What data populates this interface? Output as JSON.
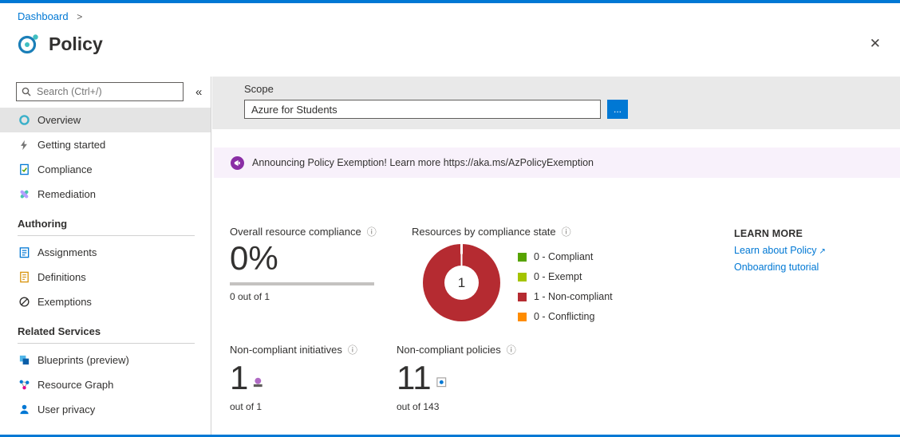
{
  "colors": {
    "brand_blue": "#0078d4",
    "non_compliant_red": "#b52b31",
    "compliant_green": "#57a300",
    "exempt_green": "#a4c400",
    "conflicting_orange": "#ff8c00",
    "banner_purple": "#8a2da5"
  },
  "icons": {
    "close": "✕",
    "collapse": "«",
    "info": "ⓘ",
    "external": "↗",
    "breadcrumb_separator": ">"
  },
  "breadcrumb": {
    "items": [
      {
        "label": "Dashboard"
      }
    ]
  },
  "page": {
    "title": "Policy"
  },
  "sidebar": {
    "search_placeholder": "Search (Ctrl+/)",
    "items": [
      {
        "label": "Overview",
        "selected": true
      },
      {
        "label": "Getting started"
      },
      {
        "label": "Compliance"
      },
      {
        "label": "Remediation"
      }
    ],
    "sections": [
      {
        "title": "Authoring",
        "items": [
          {
            "label": "Assignments"
          },
          {
            "label": "Definitions"
          },
          {
            "label": "Exemptions"
          }
        ]
      },
      {
        "title": "Related Services",
        "items": [
          {
            "label": "Blueprints (preview)"
          },
          {
            "label": "Resource Graph"
          },
          {
            "label": "User privacy"
          }
        ]
      }
    ]
  },
  "scope": {
    "label": "Scope",
    "value": "Azure for Students",
    "browse_button": "..."
  },
  "banner": {
    "message": "Announcing Policy Exemption! Learn more",
    "link": "https://aka.ms/AzPolicyExemption"
  },
  "overall_compliance": {
    "title": "Overall resource compliance",
    "percent": "0%",
    "subtext": "0 out of 1"
  },
  "compliance_state": {
    "title": "Resources by compliance state",
    "center_value": "1"
  },
  "chart_data": {
    "type": "pie",
    "title": "Resources by compliance state",
    "labels": [
      "0 - Compliant",
      "0 - Exempt",
      "1 - Non-compliant",
      "0 - Conflicting"
    ],
    "values": [
      0,
      0,
      1,
      0
    ],
    "colors": [
      "#57a300",
      "#a4c400",
      "#b52b31",
      "#ff8c00"
    ],
    "center_total": "1",
    "legend_position": "right"
  },
  "learn_more": {
    "title": "LEARN MORE",
    "links": [
      {
        "label": "Learn about Policy",
        "external": true
      },
      {
        "label": "Onboarding tutorial",
        "external": false
      }
    ]
  },
  "initiatives": {
    "title": "Non-compliant initiatives",
    "value": "1",
    "subtext": "out of 1"
  },
  "policies": {
    "title": "Non-compliant policies",
    "value": "11",
    "subtext": "out of 143"
  }
}
